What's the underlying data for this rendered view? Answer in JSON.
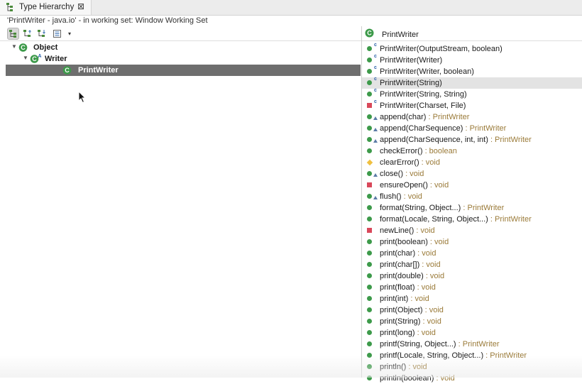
{
  "view": {
    "title": "Type Hierarchy",
    "close_glyph": "⊠",
    "status": "'PrintWriter - java.io' - in working set: Window Working Set"
  },
  "toolbar": {
    "buttons": [
      "show-type-hierarchy-icon",
      "show-supertype-hierarchy-icon",
      "show-subtype-hierarchy-icon",
      "layout-menu-icon"
    ],
    "dropdown_glyph": "▾"
  },
  "tree": [
    {
      "label": "Object",
      "indent": 0,
      "expanded": true,
      "abstract": false,
      "selected": false
    },
    {
      "label": "Writer",
      "indent": 1,
      "expanded": true,
      "abstract": true,
      "selected": false
    },
    {
      "label": "PrintWriter",
      "indent": 2,
      "expanded": false,
      "abstract": false,
      "selected": true
    }
  ],
  "members_header": {
    "title": "PrintWriter"
  },
  "members": [
    {
      "name": "PrintWriter(OutputStream, boolean)",
      "type": "",
      "visibility": "public",
      "ctor": true,
      "override": false,
      "selected": false
    },
    {
      "name": "PrintWriter(Writer)",
      "type": "",
      "visibility": "public",
      "ctor": true,
      "override": false,
      "selected": false
    },
    {
      "name": "PrintWriter(Writer, boolean)",
      "type": "",
      "visibility": "public",
      "ctor": true,
      "override": false,
      "selected": false
    },
    {
      "name": "PrintWriter(String)",
      "type": "",
      "visibility": "public",
      "ctor": true,
      "override": false,
      "selected": true
    },
    {
      "name": "PrintWriter(String, String)",
      "type": "",
      "visibility": "public",
      "ctor": true,
      "override": false,
      "selected": false
    },
    {
      "name": "PrintWriter(Charset, File)",
      "type": "",
      "visibility": "private",
      "ctor": true,
      "override": false,
      "selected": false
    },
    {
      "name": "append(char)",
      "type": " : PrintWriter",
      "visibility": "public",
      "ctor": false,
      "override": true,
      "selected": false
    },
    {
      "name": "append(CharSequence)",
      "type": " : PrintWriter",
      "visibility": "public",
      "ctor": false,
      "override": true,
      "selected": false
    },
    {
      "name": "append(CharSequence, int, int)",
      "type": " : PrintWriter",
      "visibility": "public",
      "ctor": false,
      "override": true,
      "selected": false
    },
    {
      "name": "checkError()",
      "type": " : boolean",
      "visibility": "public",
      "ctor": false,
      "override": false,
      "selected": false
    },
    {
      "name": "clearError()",
      "type": " : void",
      "visibility": "protected",
      "ctor": false,
      "override": false,
      "selected": false
    },
    {
      "name": "close()",
      "type": " : void",
      "visibility": "public",
      "ctor": false,
      "override": true,
      "selected": false
    },
    {
      "name": "ensureOpen()",
      "type": " : void",
      "visibility": "private",
      "ctor": false,
      "override": false,
      "selected": false
    },
    {
      "name": "flush()",
      "type": " : void",
      "visibility": "public",
      "ctor": false,
      "override": true,
      "selected": false
    },
    {
      "name": "format(String, Object...)",
      "type": " : PrintWriter",
      "visibility": "public",
      "ctor": false,
      "override": false,
      "selected": false
    },
    {
      "name": "format(Locale, String, Object...)",
      "type": " : PrintWriter",
      "visibility": "public",
      "ctor": false,
      "override": false,
      "selected": false
    },
    {
      "name": "newLine()",
      "type": " : void",
      "visibility": "private",
      "ctor": false,
      "override": false,
      "selected": false
    },
    {
      "name": "print(boolean)",
      "type": " : void",
      "visibility": "public",
      "ctor": false,
      "override": false,
      "selected": false
    },
    {
      "name": "print(char)",
      "type": " : void",
      "visibility": "public",
      "ctor": false,
      "override": false,
      "selected": false
    },
    {
      "name": "print(char[])",
      "type": " : void",
      "visibility": "public",
      "ctor": false,
      "override": false,
      "selected": false
    },
    {
      "name": "print(double)",
      "type": " : void",
      "visibility": "public",
      "ctor": false,
      "override": false,
      "selected": false
    },
    {
      "name": "print(float)",
      "type": " : void",
      "visibility": "public",
      "ctor": false,
      "override": false,
      "selected": false
    },
    {
      "name": "print(int)",
      "type": " : void",
      "visibility": "public",
      "ctor": false,
      "override": false,
      "selected": false
    },
    {
      "name": "print(Object)",
      "type": " : void",
      "visibility": "public",
      "ctor": false,
      "override": false,
      "selected": false
    },
    {
      "name": "print(String)",
      "type": " : void",
      "visibility": "public",
      "ctor": false,
      "override": false,
      "selected": false
    },
    {
      "name": "print(long)",
      "type": " : void",
      "visibility": "public",
      "ctor": false,
      "override": false,
      "selected": false
    },
    {
      "name": "printf(String, Object...)",
      "type": " : PrintWriter",
      "visibility": "public",
      "ctor": false,
      "override": false,
      "selected": false
    },
    {
      "name": "printf(Locale, String, Object...)",
      "type": " : PrintWriter",
      "visibility": "public",
      "ctor": false,
      "override": false,
      "selected": false
    },
    {
      "name": "println()",
      "type": " : void",
      "visibility": "public",
      "ctor": false,
      "override": false,
      "selected": false
    },
    {
      "name": "println(boolean)",
      "type": " : void",
      "visibility": "public",
      "ctor": false,
      "override": false,
      "selected": false
    }
  ],
  "colors": {
    "public": "#3d9a4a",
    "private": "#d9485a",
    "protected": "#f0c040",
    "type_suffix": "#9a7a38",
    "selection_tree": "#6e6e6e"
  }
}
